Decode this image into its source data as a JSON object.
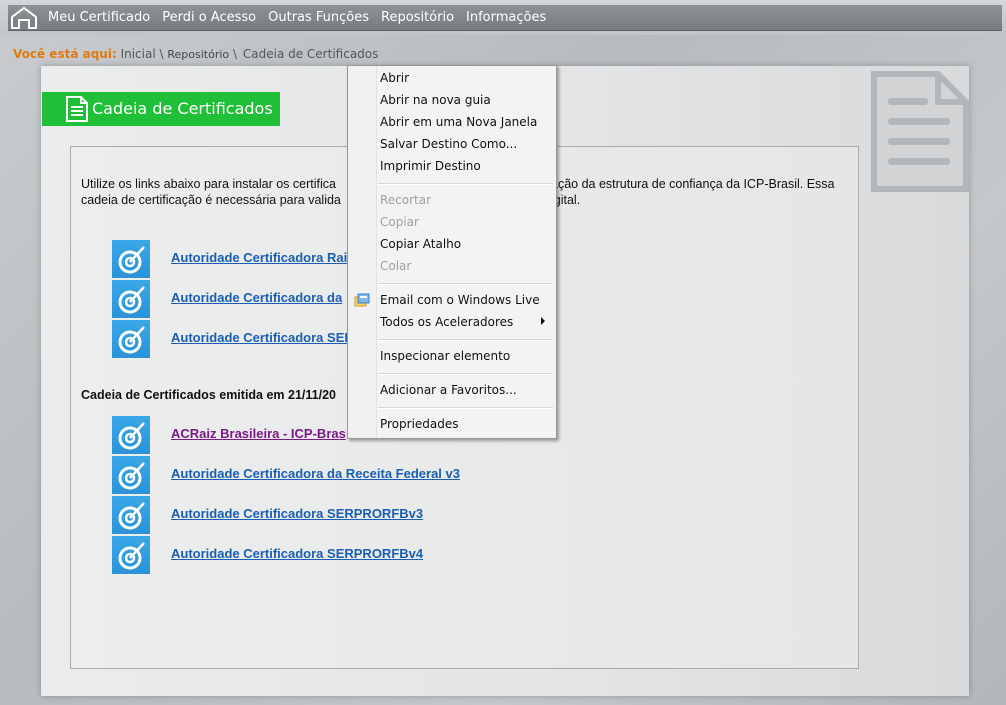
{
  "nav": {
    "items": [
      "Meu Certificado",
      "Perdi o Acesso",
      "Outras Funções",
      "Repositório",
      "Informações"
    ]
  },
  "breadcrumb": {
    "lead": "Você está aqui:",
    "items": [
      "Inicial",
      "Repositório",
      "Cadeia de Certificados"
    ]
  },
  "title": "Cadeia de Certificados",
  "intro": {
    "left": "Utilize os links abaixo para instalar os certifica",
    "left2": "cadeia de certificação é necessária para valida",
    "right": "ação da estrutura de confiança da ICP-Brasil. Essa",
    "right2": "igital."
  },
  "group1": {
    "links": [
      "Autoridade Certificadora Rai",
      "Autoridade Certificadora da",
      "Autoridade Certificadora SEF"
    ]
  },
  "group2": {
    "heading": "Cadeia de Certificados emitida em 21/11/20",
    "links": [
      "ACRaiz Brasileira - ICP-Bras",
      "Autoridade Certificadora da Receita Federal v3",
      "Autoridade Certificadora SERPRORFBv3",
      "Autoridade Certificadora SERPRORFBv4"
    ]
  },
  "context_menu": {
    "items": [
      "Abrir",
      "Abrir na nova guia",
      "Abrir em uma Nova Janela",
      "Salvar Destino Como...",
      "Imprimir Destino",
      "Recortar",
      "Copiar",
      "Copiar Atalho",
      "Colar",
      "Email com o Windows Live",
      "Todos os Aceleradores",
      "Inspecionar elemento",
      "Adicionar a Favoritos...",
      "Propriedades"
    ]
  },
  "icons": {
    "home": "home-icon",
    "document": "document-icon",
    "certificate": "certificate-icon",
    "windows_live": "windows-live-icon",
    "submenu": "chevron-right-icon"
  },
  "colors": {
    "title_bg": "#1fbf38",
    "link": "#1a5fb4",
    "visited_link": "#7a1a86",
    "breadcrumb_lead": "#e07a10",
    "cert_icon_bg": "#3aa7e8"
  }
}
